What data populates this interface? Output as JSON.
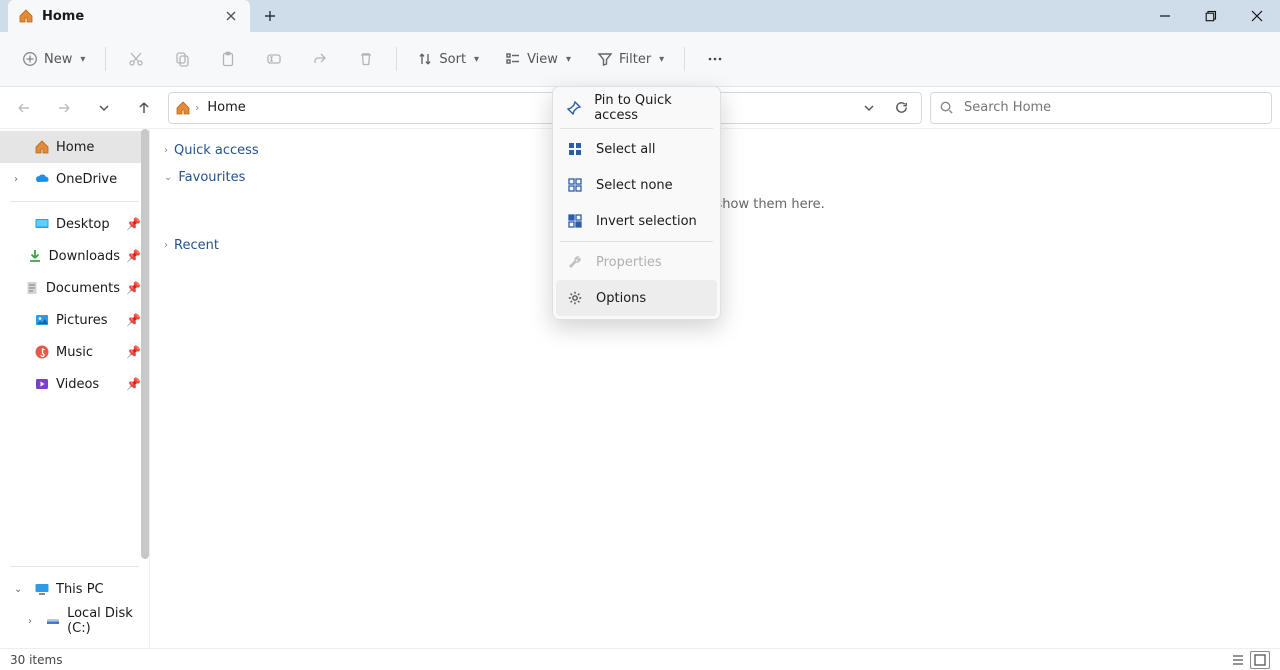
{
  "tab": {
    "title": "Home"
  },
  "toolbar": {
    "new": "New",
    "sort": "Sort",
    "view": "View",
    "filter": "Filter"
  },
  "breadcrumb": {
    "current": "Home"
  },
  "search": {
    "placeholder": "Search Home"
  },
  "sidebar": {
    "home": "Home",
    "onedrive": "OneDrive",
    "pins": [
      {
        "label": "Desktop"
      },
      {
        "label": "Downloads"
      },
      {
        "label": "Documents"
      },
      {
        "label": "Pictures"
      },
      {
        "label": "Music"
      },
      {
        "label": "Videos"
      }
    ],
    "thispc": "This PC",
    "localdisk": "Local Disk (C:)"
  },
  "groups": {
    "quick": "Quick access",
    "favourites": "Favourites",
    "recent": "Recent"
  },
  "empty_hint": "files, we'll show them here.",
  "menu": {
    "pin": "Pin to Quick access",
    "select_all": "Select all",
    "select_none": "Select none",
    "invert": "Invert selection",
    "properties": "Properties",
    "options": "Options"
  },
  "status": {
    "count": "30 items"
  }
}
